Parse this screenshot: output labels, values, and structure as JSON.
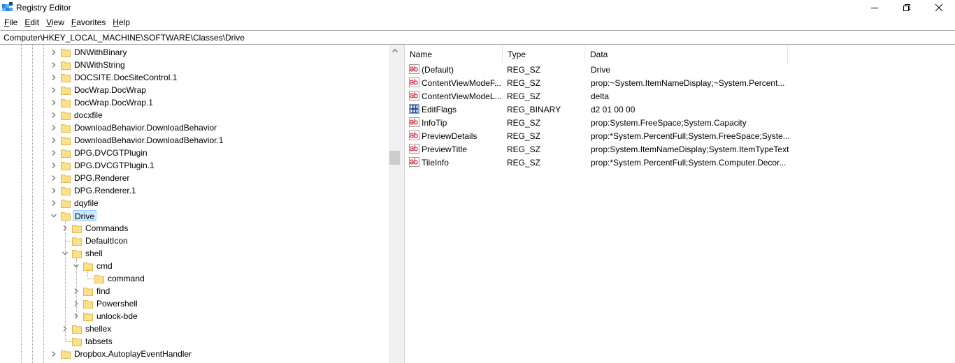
{
  "window": {
    "title": "Registry Editor"
  },
  "menu": [
    {
      "label": "File",
      "access_key": "F",
      "rest": "ile"
    },
    {
      "label": "Edit",
      "access_key": "E",
      "rest": "dit"
    },
    {
      "label": "View",
      "access_key": "V",
      "rest": "iew"
    },
    {
      "label": "Favorites",
      "access_key": "F",
      "rest": "avorites"
    },
    {
      "label": "Help",
      "access_key": "H",
      "rest": "elp"
    }
  ],
  "address": {
    "path": "Computer\\HKEY_LOCAL_MACHINE\\SOFTWARE\\Classes\\Drive"
  },
  "tree": {
    "items": [
      {
        "label": "DNWithBinary",
        "level": 0,
        "chevron": "right"
      },
      {
        "label": "DNWithString",
        "level": 0,
        "chevron": "right"
      },
      {
        "label": "DOCSITE.DocSiteControl.1",
        "level": 0,
        "chevron": "right"
      },
      {
        "label": "DocWrap.DocWrap",
        "level": 0,
        "chevron": "right"
      },
      {
        "label": "DocWrap.DocWrap.1",
        "level": 0,
        "chevron": "right"
      },
      {
        "label": "docxfile",
        "level": 0,
        "chevron": "right"
      },
      {
        "label": "DownloadBehavior.DownloadBehavior",
        "level": 0,
        "chevron": "right"
      },
      {
        "label": "DownloadBehavior.DownloadBehavior.1",
        "level": 0,
        "chevron": "right"
      },
      {
        "label": "DPG.DVCGTPlugin",
        "level": 0,
        "chevron": "right"
      },
      {
        "label": "DPG.DVCGTPlugin.1",
        "level": 0,
        "chevron": "right"
      },
      {
        "label": "DPG.Renderer",
        "level": 0,
        "chevron": "right"
      },
      {
        "label": "DPG.Renderer.1",
        "level": 0,
        "chevron": "right"
      },
      {
        "label": "dqyfile",
        "level": 0,
        "chevron": "right"
      },
      {
        "label": "Drive",
        "level": 0,
        "chevron": "down",
        "selected": true
      },
      {
        "label": "Commands",
        "level": 1,
        "chevron": "right"
      },
      {
        "label": "DefaultIcon",
        "level": 1,
        "chevron": "none"
      },
      {
        "label": "shell",
        "level": 1,
        "chevron": "down"
      },
      {
        "label": "cmd",
        "level": 2,
        "chevron": "down"
      },
      {
        "label": "command",
        "level": 3,
        "chevron": "none"
      },
      {
        "label": "find",
        "level": 2,
        "chevron": "right"
      },
      {
        "label": "Powershell",
        "level": 2,
        "chevron": "right"
      },
      {
        "label": "unlock-bde",
        "level": 2,
        "chevron": "right"
      },
      {
        "label": "shellex",
        "level": 1,
        "chevron": "right"
      },
      {
        "label": "tabsets",
        "level": 1,
        "chevron": "none"
      },
      {
        "label": "Dropbox.AutoplayEventHandler",
        "level": 0,
        "chevron": "right"
      }
    ]
  },
  "list": {
    "columns": [
      "Name",
      "Type",
      "Data"
    ],
    "rows": [
      {
        "icon": "string-value-icon",
        "name": "(Default)",
        "type": "REG_SZ",
        "data": "Drive"
      },
      {
        "icon": "string-value-icon",
        "name": "ContentViewModeF...",
        "type": "REG_SZ",
        "data": "prop:~System.ItemNameDisplay;~System.Percent..."
      },
      {
        "icon": "string-value-icon",
        "name": "ContentViewModeL...",
        "type": "REG_SZ",
        "data": "delta"
      },
      {
        "icon": "binary-value-icon",
        "name": "EditFlags",
        "type": "REG_BINARY",
        "data": "d2 01 00 00"
      },
      {
        "icon": "string-value-icon",
        "name": "InfoTip",
        "type": "REG_SZ",
        "data": "prop:System.FreeSpace;System.Capacity"
      },
      {
        "icon": "string-value-icon",
        "name": "PreviewDetails",
        "type": "REG_SZ",
        "data": "prop:*System.PercentFull;System.FreeSpace;Syste..."
      },
      {
        "icon": "string-value-icon",
        "name": "PreviewTitle",
        "type": "REG_SZ",
        "data": "prop:System.ItemNameDisplay;System.ItemTypeText"
      },
      {
        "icon": "string-value-icon",
        "name": "TileInfo",
        "type": "REG_SZ",
        "data": "prop:*System.PercentFull;System.Computer.Decor..."
      }
    ]
  },
  "colors": {
    "selection_bg": "#cce8ff",
    "folder": "#ffe08a",
    "string_icon": "#c8102e"
  }
}
